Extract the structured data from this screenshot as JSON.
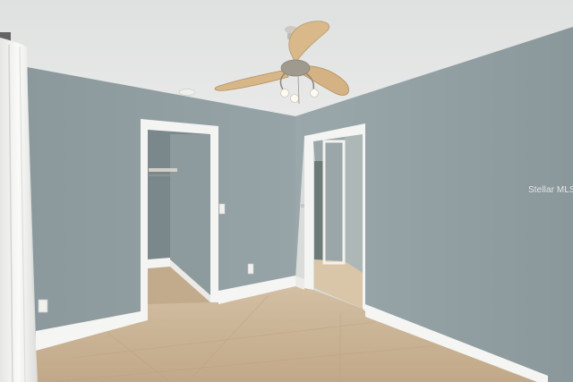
{
  "watermark": {
    "text": "Stellar MLS"
  },
  "scene": {
    "colors": {
      "wall": "#93a1a5",
      "wall_shadow": "#7f8d92",
      "ceiling": "#e2e4e3",
      "floor": "#c7af93",
      "trim": "#f7f7f5",
      "fan_blade": "#d9b98a",
      "curtain": "#f3f3f1"
    }
  }
}
